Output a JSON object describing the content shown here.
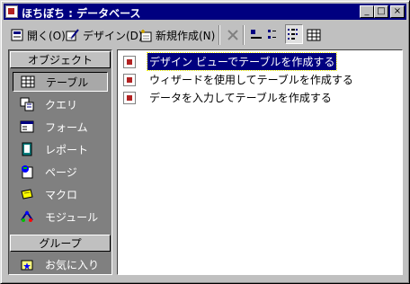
{
  "window": {
    "title": "ほちぼち : データベース"
  },
  "title_buttons": {
    "minimize": "_",
    "maximize": "□",
    "close": "×"
  },
  "toolbar": {
    "open_label": "開く(O)",
    "design_label": "デザイン(D)",
    "new_label": "新規作成(N)"
  },
  "left_pane": {
    "objects_header": "オブジェクト",
    "objects": [
      {
        "label": "テーブル",
        "icon": "table-icon"
      },
      {
        "label": "クエリ",
        "icon": "query-icon"
      },
      {
        "label": "フォーム",
        "icon": "form-icon"
      },
      {
        "label": "レポート",
        "icon": "report-icon"
      },
      {
        "label": "ページ",
        "icon": "page-icon"
      },
      {
        "label": "マクロ",
        "icon": "macro-icon"
      },
      {
        "label": "モジュール",
        "icon": "module-icon"
      }
    ],
    "groups_header": "グループ",
    "groups": [
      {
        "label": "お気に入り",
        "icon": "favorites-icon"
      }
    ]
  },
  "list": {
    "items": [
      {
        "label": "デザイン ビューでテーブルを作成する",
        "selected": true
      },
      {
        "label": "ウィザードを使用してテーブルを作成する",
        "selected": false
      },
      {
        "label": "データを入力してテーブルを作成する",
        "selected": false
      }
    ]
  },
  "colors": {
    "titlebar": "#000080",
    "selection": "#000080",
    "pane": "#808080"
  }
}
